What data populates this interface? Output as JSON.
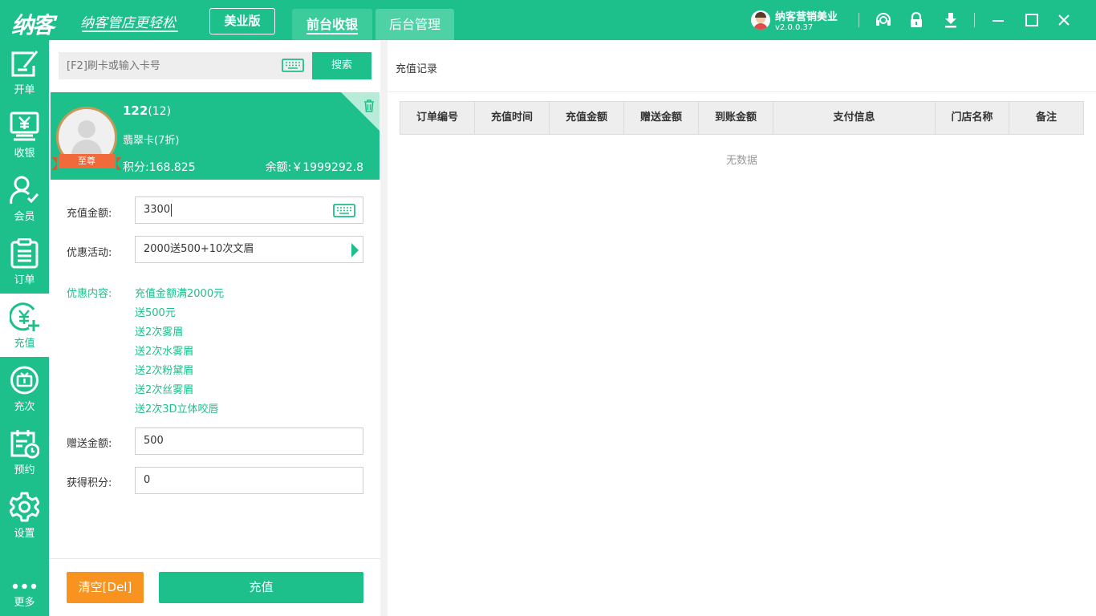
{
  "colors": {
    "primary": "#1dbf8a",
    "orange": "#f7931e",
    "ribbon": "#f06a3b"
  },
  "header": {
    "logo": "纳客",
    "slogan": "纳客管店更轻松",
    "edition": "美业版",
    "tabs": [
      {
        "label": "前台收银",
        "active": true
      },
      {
        "label": "后台管理",
        "active": false
      }
    ],
    "user": {
      "name": "纳客营销美业",
      "version": "v2.0.0.37"
    },
    "icons": [
      "headset-icon",
      "lock-icon",
      "download-icon",
      "minimize-icon",
      "maximize-icon",
      "close-icon"
    ]
  },
  "nav": [
    {
      "label": "开单",
      "icon": "edit-icon"
    },
    {
      "label": "收银",
      "icon": "cashier-icon"
    },
    {
      "label": "会员",
      "icon": "member-icon"
    },
    {
      "label": "订单",
      "icon": "order-icon"
    },
    {
      "label": "充值",
      "icon": "recharge-icon",
      "active": true
    },
    {
      "label": "充次",
      "icon": "count-icon"
    },
    {
      "label": "预约",
      "icon": "appointment-icon"
    },
    {
      "label": "设置",
      "icon": "settings-icon"
    },
    {
      "label": "更多",
      "icon": "more-icon"
    }
  ],
  "search": {
    "placeholder": "[F2]刷卡或输入卡号",
    "button": "搜索"
  },
  "member": {
    "name": "122",
    "count": "(12)",
    "card_type": "翡翠卡(7折)",
    "level": "至尊",
    "points": "积分:168.825",
    "balance": "余额:￥1999292.8"
  },
  "form": {
    "amount_label": "充值金额:",
    "amount_value": "3300",
    "promo_label": "优惠活动:",
    "promo_value": "2000送500+10次文眉",
    "promo_content_label": "优惠内容:",
    "promo_content": [
      "充值金额满2000元",
      "送500元",
      "送2次雾眉",
      "送2次水雾眉",
      "送2次粉黛眉",
      "送2次丝雾眉",
      "送2次3D立体咬唇"
    ],
    "bonus_label": "赠送金额:",
    "bonus_value": "500",
    "earn_points_label": "获得积分:",
    "earn_points_value": "0"
  },
  "actions": {
    "clear": "清空[Del]",
    "charge": "充值"
  },
  "records": {
    "title": "充值记录",
    "columns": [
      "订单编号",
      "充值时间",
      "充值金额",
      "赠送金额",
      "到账金额",
      "支付信息",
      "门店名称",
      "备注"
    ],
    "empty": "无数据"
  }
}
